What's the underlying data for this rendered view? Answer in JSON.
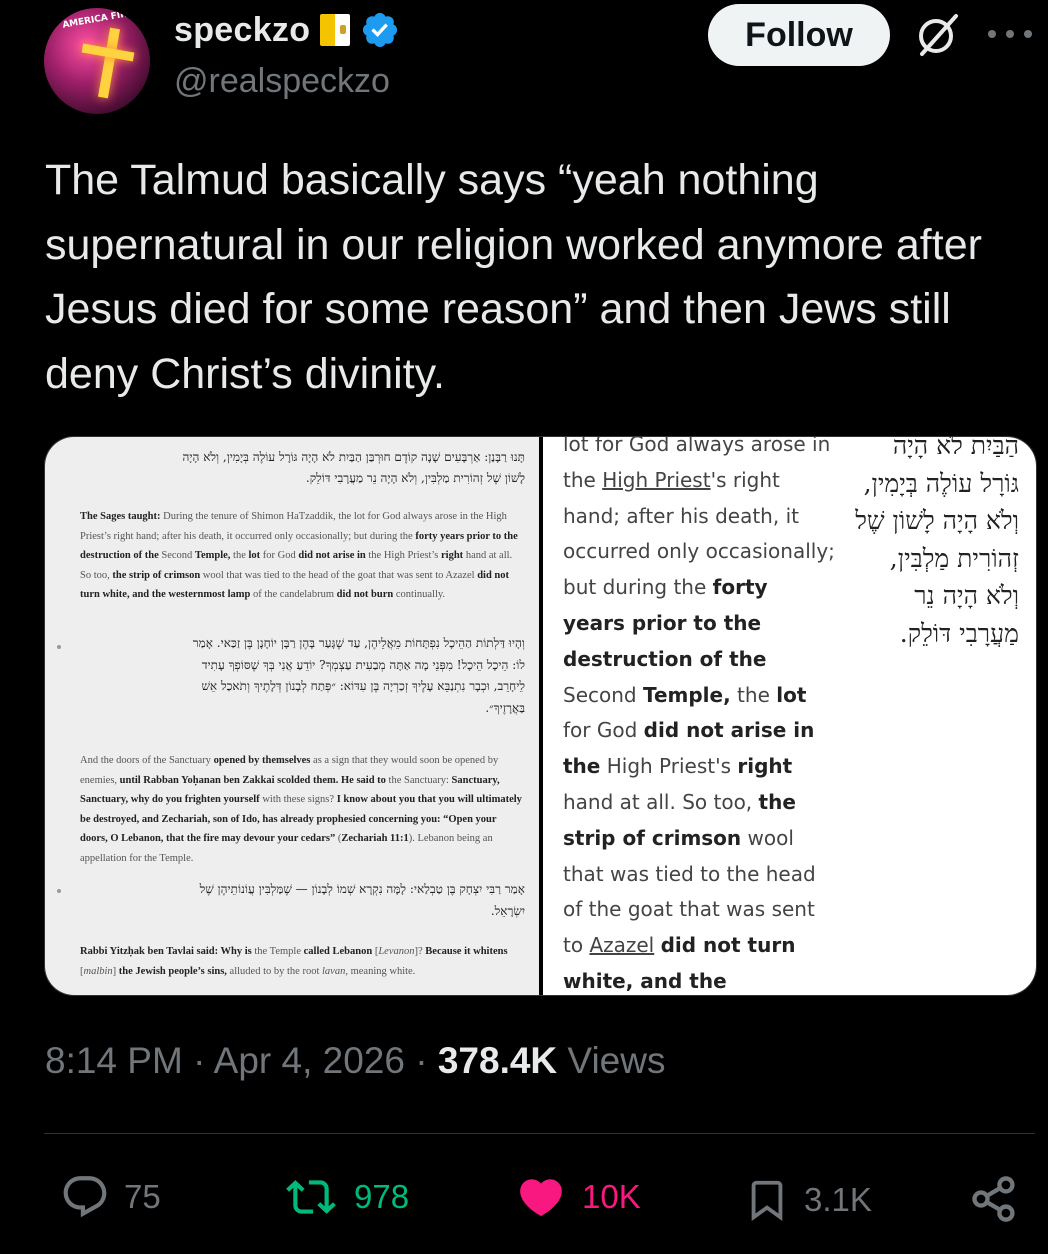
{
  "user": {
    "display_name": "speckzo",
    "handle": "@realspeckzo",
    "avatar_text": "AMERICA FIRST"
  },
  "header": {
    "follow_label": "Follow"
  },
  "tweet": {
    "text": "The Talmud basically says “yeah nothing supernatural in our religion worked anymore after Jesus died for some reason” and then Jews still deny Christ’s divinity."
  },
  "media_left": {
    "hebrew_1_line1": "תָּנוּ רַבָּנַן: אַרְבָּעִים שָׁנָה קוֹדֶם חוּרְבַּן הַבַּיִת לֹא הָיָה גּוֹרָל עוֹלֶה בְּיָמִין, וְלֹא הָיָה",
    "hebrew_1_line2": "לָשׁוֹן שֶׁל זְהוֹרִית מַלְבִּין, וְלֹא הָיָה נֵר מַעֲרָבִי דּוֹלֵק.",
    "english_1_html": "<b>The Sages taught:</b> During the tenure of Shimon HaTzaddik, the lot for God always arose in the High Priest’s right hand; after his death, it occurred only occasionally; but during the <b>forty years prior to the destruction of the</b> Second <b>Temple,</b> the <b>lot</b> for God <b>did not arise in</b> the High Priest’s <b>right</b> hand at all. So too, <b>the strip of crimson</b> wool that was tied to the head of the goat that was sent to Azazel <b>did not turn white, and the westernmost lamp</b> of the candelabrum <b>did not burn</b> continually.",
    "hebrew_2_line1": "וְהָיוּ דַּלְתוֹת הַהֵיכָל נִפְתָּחוֹת מֵאֲלֵיהֶן, עַד שֶׁגָּעַר בָּהֶן רַבָּן יוֹחָנָן בֶּן זַכַּאי. אָמַר",
    "hebrew_2_line2": "לוֹ: הֵיכָל הֵיכָל! מִפְּנֵי מָה אַתָּה מְבַעִית עַצְמְךָ? יוֹדֵעַ אֲנִי בְּךָ שֶׁסּוֹפְךָ עָתִיד",
    "hebrew_2_line3": "לֵיחָרֵב, וּכְבָר נִתְנַבֵּא עָלֶיךָ זְכַרְיָה בֶּן עִדּוֹא: ״פְּתַח לְבָנוֹן דְּלָתֶיךָ וְתֹאכַל אֵשׁ",
    "hebrew_2_line4": "בַּאֲרָזֶיךָ״.",
    "english_2_html": "And the doors of the Sanctuary <b>opened by themselves</b> as a sign that they would soon be opened by enemies, <b>until Rabban Yoḥanan ben Zakkai scolded them. He said to</b> the Sanctuary: <b>Sanctuary, Sanctuary, why do you frighten yourself</b> with these signs? <b>I know about you that you will ultimately be destroyed, and Zechariah, son of Ido, has already prophesied concerning you: “Open your doors, O Lebanon, that the fire may devour your cedars”</b> (<b>Zechariah 11:1</b>). Lebanon being an appellation for the Temple.",
    "hebrew_3_line1": "אָמַר רַבִּי יִצְחָק בֶּן טַבְלַאי: לָמָּה נִקְרָא שְׁמוֹ לְבָנוֹן — שֶׁמַּלְבִּין עֲוֹנוֹתֵיהֶן שֶׁל",
    "hebrew_3_line2": "יִשְׂרָאֵל.",
    "english_3_html": "<b>Rabbi Yitzḥak ben Tavlai said: Why is</b> the Temple <b>called Lebanon</b> [<i>Levanon</i>]? <b>Because it whitens</b> [<i>malbin</i>] <b>the Jewish people’s sins,</b> alluded to by the root <i>lavan,</i> meaning white."
  },
  "media_right": {
    "english_html": "lot for God always arose in the <u>High Priest</u>'s right hand; after his death, it occurred only occasionally; but during the <b>forty years prior to the destruction of the</b> Second <b>Temple,</b> the <b>lot</b> for God <b>did not arise in the</b> High Priest's <b>right</b> hand at all. So too, <b>the strip of crimson</b> wool that was tied to the head of the goat that was sent to <u>Azazel</u> <b>did not turn white, and the</b>",
    "hebrew_lines": [
      "הַבַּיִת לֹא הָיָה",
      "גּוֹרָל עוֹלֶה בְּיָמִין,",
      "וְלֹא הָיָה לָשׁוֹן שֶׁל",
      "זְהוֹרִית מַלְבִּין,",
      "וְלֹא הָיָה נֵר",
      "מַעֲרָבִי דּוֹלֵק."
    ]
  },
  "meta": {
    "time": "8:14 PM",
    "sep1": " · ",
    "date": "Apr 4, 2026",
    "sep2": " · ",
    "views_count": "378.4K",
    "views_label": " Views"
  },
  "actions": {
    "replies": "75",
    "reposts": "978",
    "likes": "10K",
    "bookmarks": "3.1K"
  },
  "colors": {
    "repost": "#00ba7c",
    "like": "#f91880",
    "verified": "#1d9bf0",
    "muted": "#71767b"
  }
}
